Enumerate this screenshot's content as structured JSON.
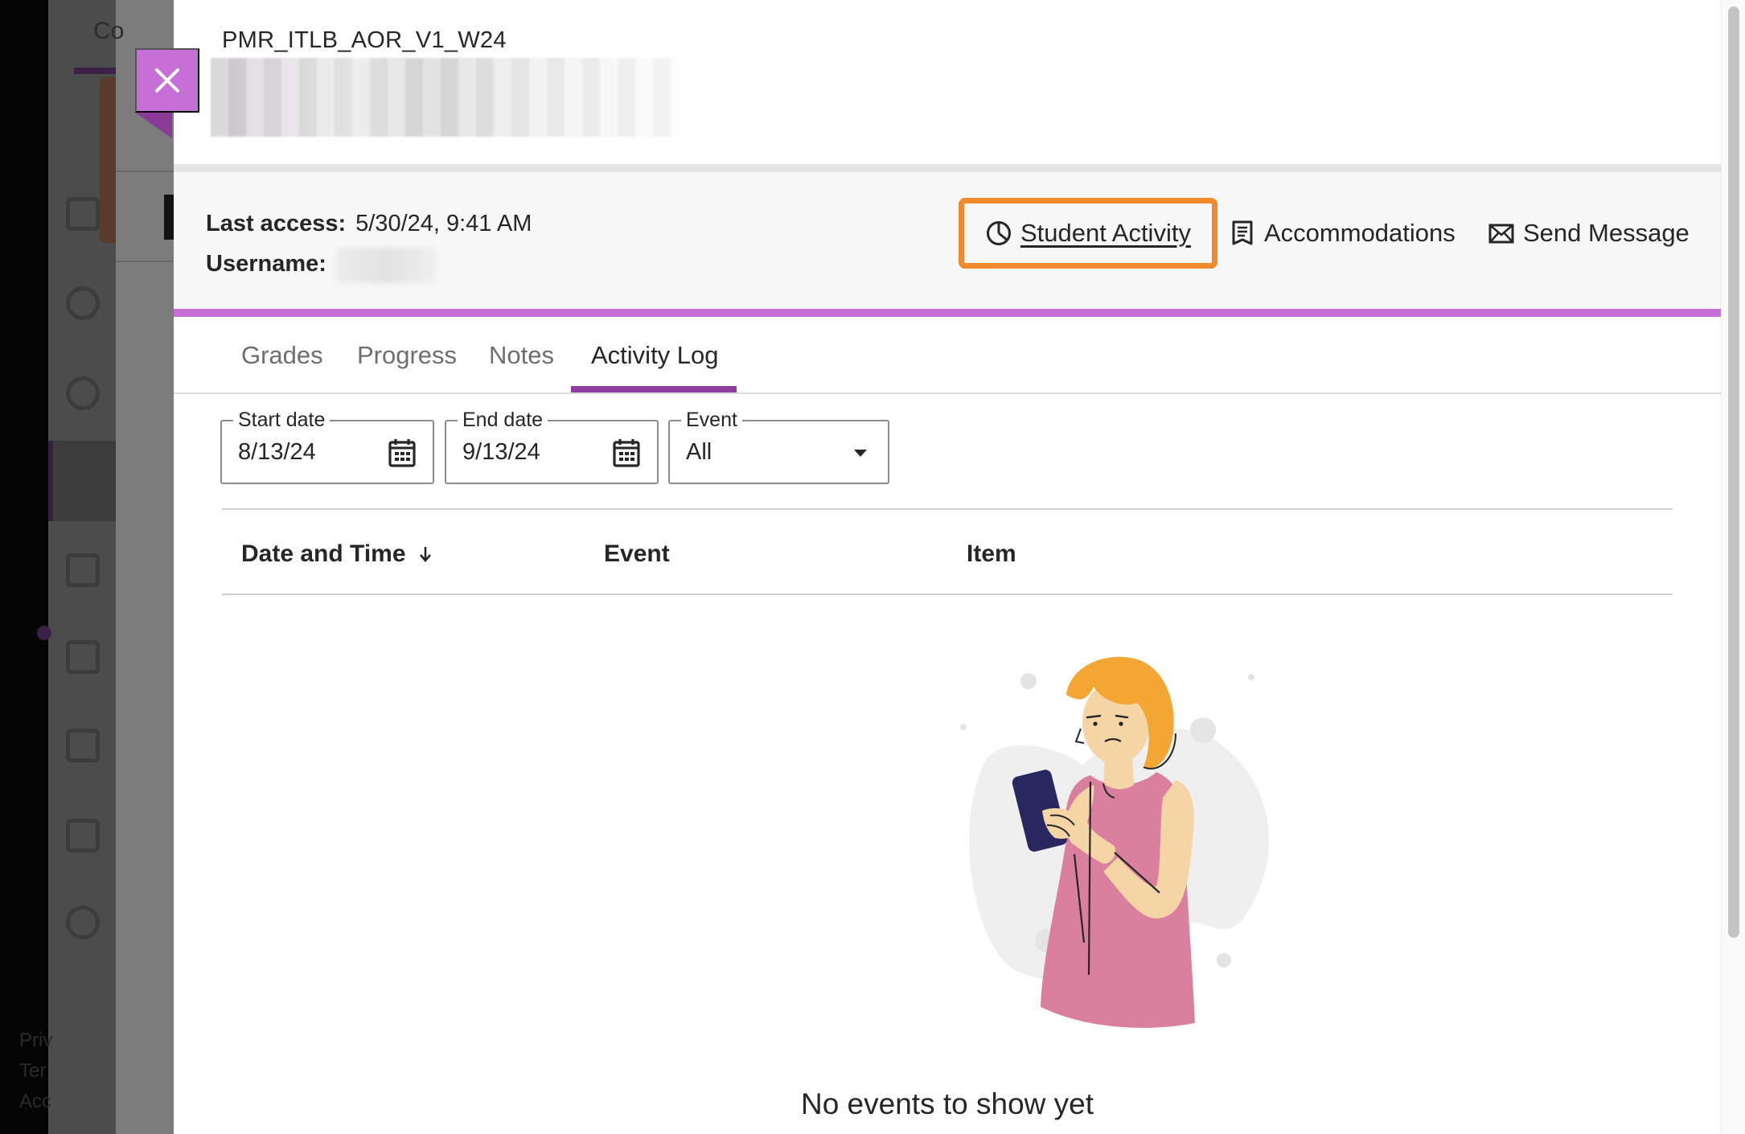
{
  "background": {
    "tab_text": "Co",
    "footer_lines": [
      "Priv",
      "Ter",
      "Acc"
    ]
  },
  "close_button": {
    "icon": "close-icon"
  },
  "header": {
    "course_code": "PMR_ITLB_AOR_V1_W24"
  },
  "info": {
    "last_access_label": "Last access:",
    "last_access_value": "5/30/24, 9:41 AM",
    "username_label": "Username:"
  },
  "actions": {
    "student_activity": "Student Activity",
    "accommodations": "Accommodations",
    "send_message": "Send Message"
  },
  "tabs": [
    {
      "label": "Grades"
    },
    {
      "label": "Progress"
    },
    {
      "label": "Notes"
    },
    {
      "label": "Activity Log"
    }
  ],
  "filters": {
    "start_date": {
      "label": "Start date",
      "value": "8/13/24"
    },
    "end_date": {
      "label": "End date",
      "value": "9/13/24"
    },
    "event": {
      "label": "Event",
      "value": "All"
    }
  },
  "table": {
    "columns": [
      "Date and Time",
      "Event",
      "Item"
    ]
  },
  "empty_state": {
    "message": "No events to show yet"
  },
  "colors": {
    "accent_purple": "#c66fd7",
    "tab_active": "#8e3ca0",
    "highlight_orange": "#f08a2c"
  }
}
